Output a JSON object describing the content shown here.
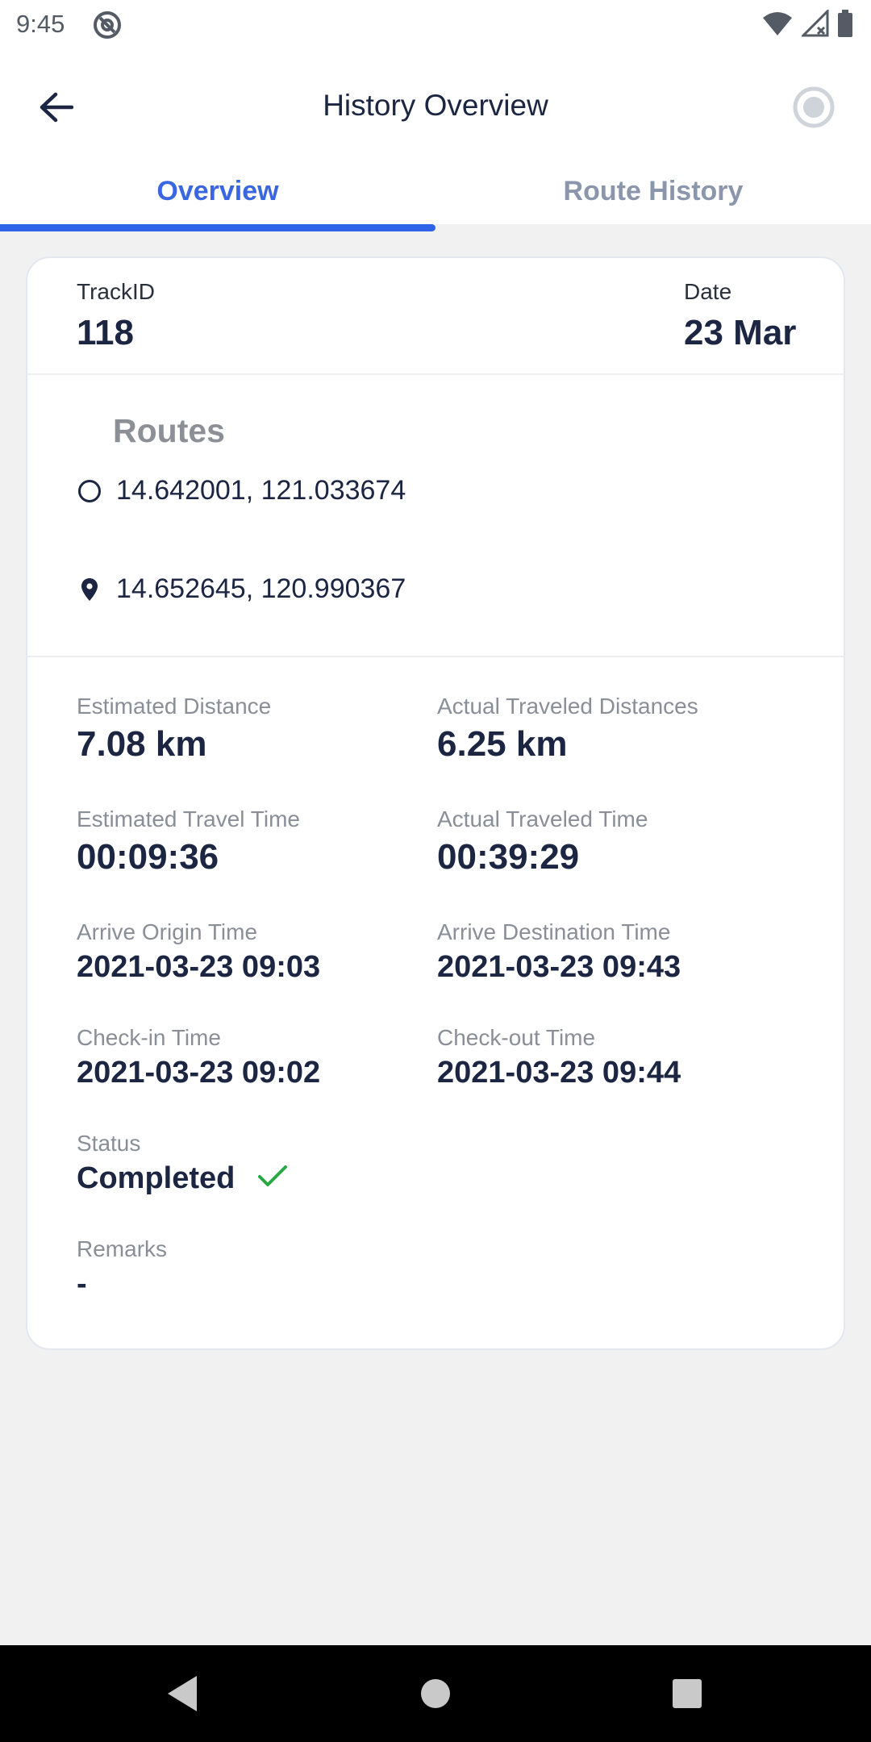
{
  "status_bar": {
    "time": "9:45"
  },
  "app_bar": {
    "title": "History Overview"
  },
  "tabs": [
    {
      "label": "Overview",
      "active": true
    },
    {
      "label": "Route History",
      "active": false
    }
  ],
  "track": {
    "track_id_label": "TrackID",
    "track_id_value": "118",
    "date_label": "Date",
    "date_value": "23 Mar"
  },
  "routes": {
    "title": "Routes",
    "origin": "14.642001, 121.033674",
    "destination": "14.652645, 120.990367"
  },
  "stats": {
    "estimated_distance_label": "Estimated Distance",
    "estimated_distance_value": "7.08 km",
    "actual_distance_label": "Actual Traveled Distances",
    "actual_distance_value": "6.25 km",
    "estimated_time_label": "Estimated Travel Time",
    "estimated_time_value": "00:09:36",
    "actual_time_label": "Actual Traveled Time",
    "actual_time_value": "00:39:29",
    "arrive_origin_label": "Arrive Origin Time",
    "arrive_origin_value": "2021-03-23 09:03",
    "arrive_destination_label": "Arrive Destination Time",
    "arrive_destination_value": "2021-03-23 09:43",
    "checkin_label": "Check-in Time",
    "checkin_value": "2021-03-23 09:02",
    "checkout_label": "Check-out Time",
    "checkout_value": "2021-03-23 09:44",
    "status_label": "Status",
    "status_value": "Completed",
    "remarks_label": "Remarks",
    "remarks_value": "-"
  },
  "colors": {
    "accent": "#2f63e8",
    "success": "#27a844",
    "text": "#1c2541",
    "muted": "#8a8e97"
  },
  "icons": [
    "back-arrow-icon",
    "record-icon",
    "origin-circle-icon",
    "location-pin-icon",
    "check-icon"
  ]
}
